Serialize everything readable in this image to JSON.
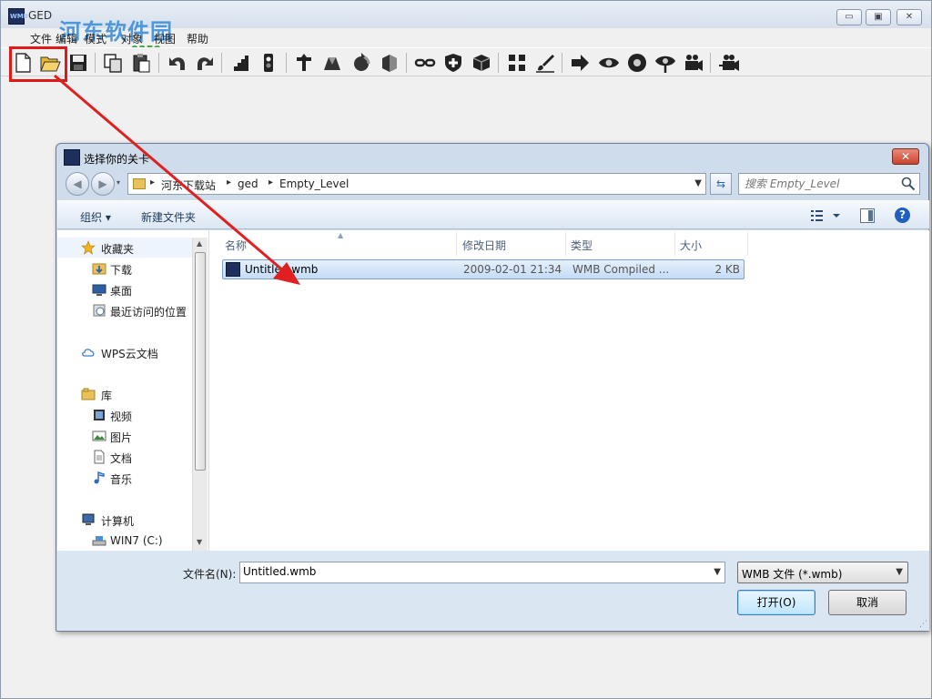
{
  "app": {
    "title": "GED",
    "logo_text": "WMB",
    "watermark": "河东软件园",
    "watermark_url": "www.pc0359.cn",
    "menus": [
      "文件",
      "编辑",
      "模式",
      "对象",
      "视图",
      "帮助"
    ],
    "window_buttons": {
      "minimize": "▭",
      "restore": "▣",
      "close": "✕"
    }
  },
  "toolbar": {
    "buttons": [
      "new-file",
      "open-folder",
      "save",
      "copy",
      "paste",
      "undo",
      "redo",
      "stairs",
      "light",
      "entity",
      "terrain",
      "rotate",
      "block",
      "link",
      "shield",
      "cube",
      "move-all",
      "paint",
      "import",
      "eye",
      "eye-rotate",
      "eye-pin",
      "camera",
      "camera-2"
    ]
  },
  "dialog": {
    "title": "选择你的关卡",
    "close_label": "✕",
    "breadcrumb": [
      "河东下载站",
      "ged",
      "Empty_Level"
    ],
    "search_placeholder": "搜索 Empty_Level",
    "commands": {
      "organize": "组织 ▾",
      "new_folder": "新建文件夹"
    },
    "help_label": "?",
    "nav": {
      "favorites": "收藏夹",
      "downloads": "下载",
      "desktop": "桌面",
      "recent": "最近访问的位置",
      "wps": "WPS云文档",
      "libraries": "库",
      "videos": "视频",
      "pictures": "图片",
      "documents": "文档",
      "music": "音乐",
      "computer": "计算机",
      "drive_c": "WIN7 (C:)"
    },
    "columns": [
      "名称",
      "修改日期",
      "类型",
      "大小"
    ],
    "files": [
      {
        "name": "Untitled.wmb",
        "modified": "2009-02-01 21:34",
        "type": "WMB Compiled ...",
        "size": "2 KB"
      }
    ],
    "footer": {
      "filename_label": "文件名(N):",
      "filename_value": "Untitled.wmb",
      "filetype": "WMB 文件 (*.wmb)",
      "open_label": "打开(O)",
      "cancel_label": "取消"
    }
  },
  "colors": {
    "highlight": "#e01818",
    "arrow": "#e02020",
    "selection": "#c5dcf6"
  }
}
